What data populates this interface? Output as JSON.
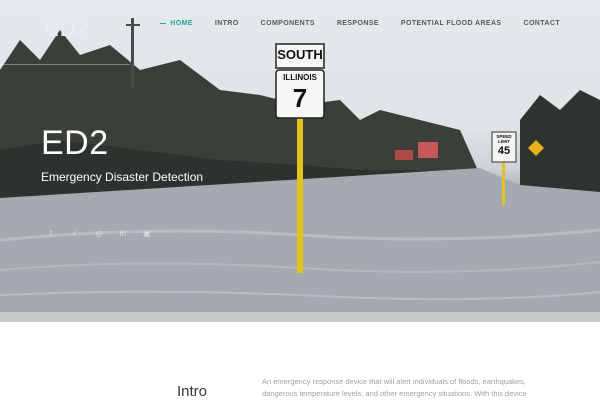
{
  "brand": {
    "logo_text": "ED2"
  },
  "nav": {
    "items": [
      {
        "label": "HOME",
        "active": true
      },
      {
        "label": "INTRO",
        "active": false
      },
      {
        "label": "COMPONENTS",
        "active": false
      },
      {
        "label": "RESPONSE",
        "active": false
      },
      {
        "label": "POTENTIAL FLOOD AREAS",
        "active": false
      },
      {
        "label": "CONTACT",
        "active": false
      }
    ],
    "accent_color": "#2aa59b"
  },
  "hero": {
    "title": "ED2",
    "subtitle": "Emergency Disaster Detection",
    "signs": {
      "route_header": "SOUTH",
      "route_state": "ILLINOIS",
      "route_number": "7",
      "speed_top": "SPEED",
      "speed_mid": "LIMIT",
      "speed_value": "45"
    },
    "social_icons": [
      "facebook-icon",
      "twitter-icon",
      "dribbble-icon",
      "linkedin-icon",
      "instagram-icon"
    ]
  },
  "intro": {
    "heading": "Intro",
    "text": "An emergency response device that will alert individuals of floods, earthquakes, dangerous temperature levels, and other emergency situations. With this device connected to the AWS Cloud,"
  }
}
